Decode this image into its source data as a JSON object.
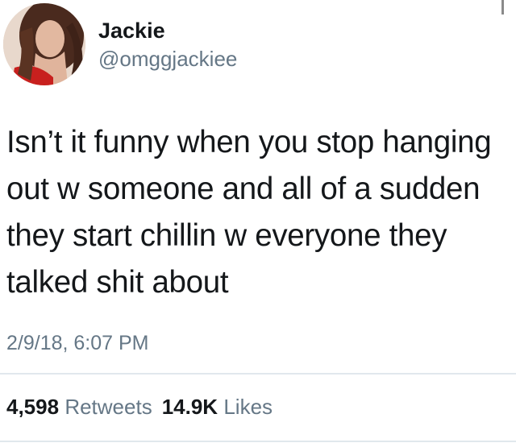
{
  "user": {
    "name": "Jackie",
    "handle": "@omggjackiee",
    "avatar_icon": "profile-photo"
  },
  "tweet": {
    "lines": [
      "Isn’t it funny when you stop hanging",
      "out w someone and all of a sudden",
      "they start chillin w everyone they",
      "talked shit about"
    ],
    "timestamp": "2/9/18, 6:07 PM"
  },
  "stats": {
    "retweets_count": "4,598",
    "retweets_label": "Retweets",
    "likes_count": "14.9K",
    "likes_label": "Likes"
  },
  "colors": {
    "text": "#14171a",
    "secondary": "#657786",
    "divider": "#e1e8ed"
  }
}
